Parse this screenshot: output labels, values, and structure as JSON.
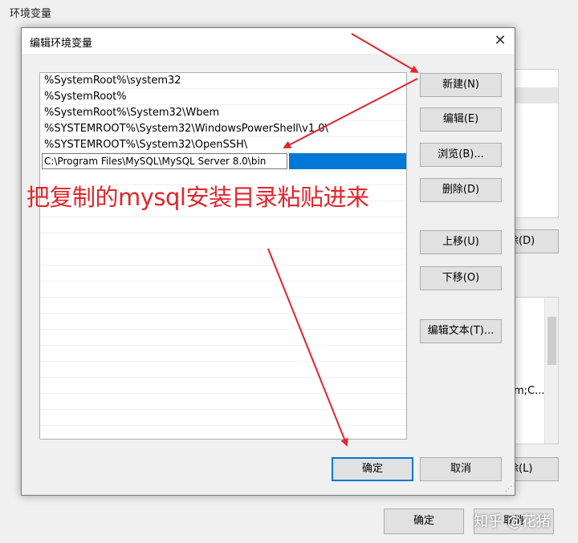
{
  "background_window": {
    "title": "环境变量",
    "fragment_delete_top": "除(D)",
    "sys_list_text": "m;C...",
    "fragment_delete_bottom": "除(L)",
    "ok_label": "确定",
    "cancel_label": "取消"
  },
  "dialog": {
    "title": "编辑环境变量",
    "close_glyph": "✕",
    "paths": [
      "%SystemRoot%\\system32",
      "%SystemRoot%",
      "%SystemRoot%\\System32\\Wbem",
      "%SYSTEMROOT%\\System32\\WindowsPowerShell\\v1.0\\",
      "%SYSTEMROOT%\\System32\\OpenSSH\\"
    ],
    "editing_value": "C:\\Program Files\\MySQL\\MySQL Server 8.0\\bin",
    "buttons": {
      "new": "新建(N)",
      "edit": "编辑(E)",
      "browse": "浏览(B)...",
      "delete": "删除(D)",
      "move_up": "上移(U)",
      "move_down": "下移(O)",
      "edit_text": "编辑文本(T)...",
      "ok": "确定",
      "cancel": "取消"
    }
  },
  "annotation_text": "把复制的mysql安装目录粘贴进来",
  "watermark": "知乎 @花猪",
  "colors": {
    "annotation": "#e0262d",
    "selection": "#0078d7"
  }
}
